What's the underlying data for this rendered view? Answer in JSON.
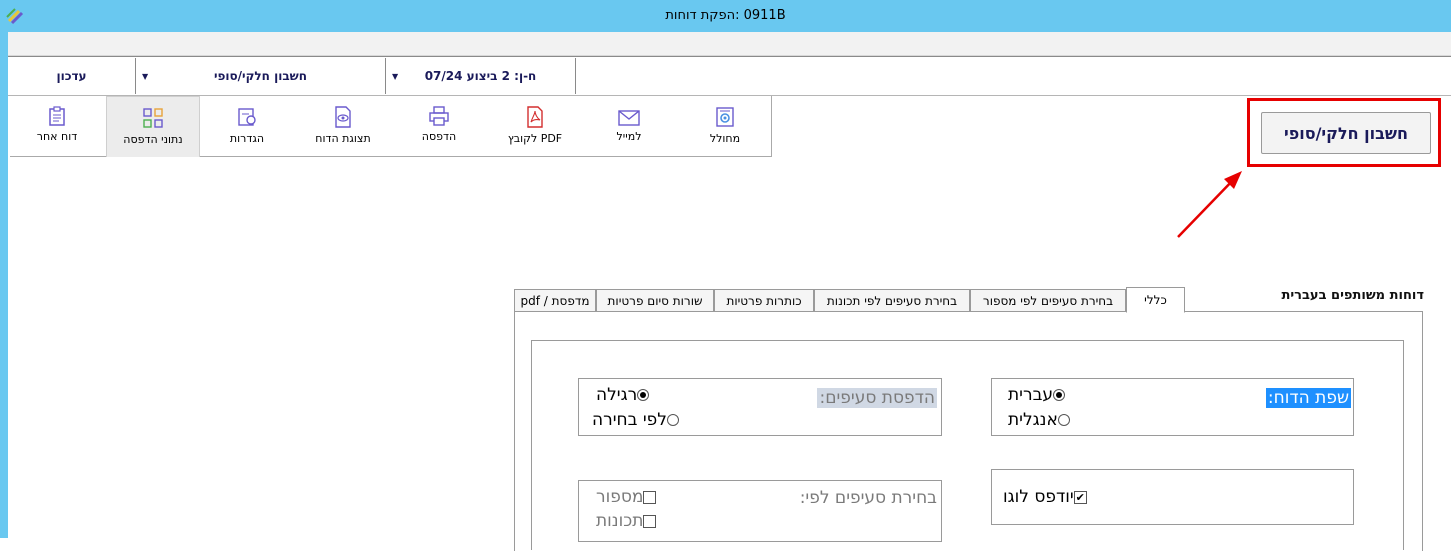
{
  "window": {
    "title": "0911B :הפקת דוחות"
  },
  "selectors": {
    "update": "עדכון",
    "account": "חשבון חלקי/סופי",
    "execution": "ח-ן: 2 ביצוע 07/24"
  },
  "toolbar": {
    "items": [
      {
        "label": "מחולל",
        "icon": "generator-icon"
      },
      {
        "label": "למייל",
        "icon": "mail-icon"
      },
      {
        "label": "PDF לקובץ",
        "icon": "pdf-icon"
      },
      {
        "label": "הדפסה",
        "icon": "printer-icon"
      },
      {
        "label": "תצוגת הדוח",
        "icon": "preview-icon"
      },
      {
        "label": "הגדרות",
        "icon": "settings-icon"
      },
      {
        "label": "נתוני הדפסה",
        "icon": "grid-icon"
      },
      {
        "label": "דוח אחר",
        "icon": "report-icon"
      }
    ]
  },
  "main_button": {
    "label": "חשבון חלקי/סופי"
  },
  "section": {
    "heading": "דוחות משותפים בעברית"
  },
  "tabs": [
    {
      "label": "כללי"
    },
    {
      "label": "בחירת סעיפים לפי מספור"
    },
    {
      "label": "בחירת סעיפים לפי תכונות"
    },
    {
      "label": "כותרות פרטיות"
    },
    {
      "label": "שורות סיום פרטיות"
    },
    {
      "label": "מדפסת / pdf"
    }
  ],
  "report_language": {
    "label": "שפת הדוח:",
    "options": [
      {
        "label": "עברית",
        "selected": true
      },
      {
        "label": "אנגלית",
        "selected": false
      }
    ]
  },
  "print_sections": {
    "label": "הדפסת סעיפים:",
    "options": [
      {
        "label": "רגילה",
        "selected": true
      },
      {
        "label": "לפי בחירה",
        "selected": false
      }
    ]
  },
  "logo": {
    "label": "יודפס לוגו",
    "checked": true
  },
  "section_select": {
    "label": "בחירת סעיפים לפי:",
    "options": [
      {
        "label": "מספור",
        "checked": false
      },
      {
        "label": "תכונות",
        "checked": false
      }
    ]
  },
  "colors": {
    "titlebar": "#69c8f0",
    "highlight": "#1e90ff",
    "disabled_highlight": "#d0d8e4",
    "callout": "#e60000",
    "navy": "#1a1a5a"
  }
}
